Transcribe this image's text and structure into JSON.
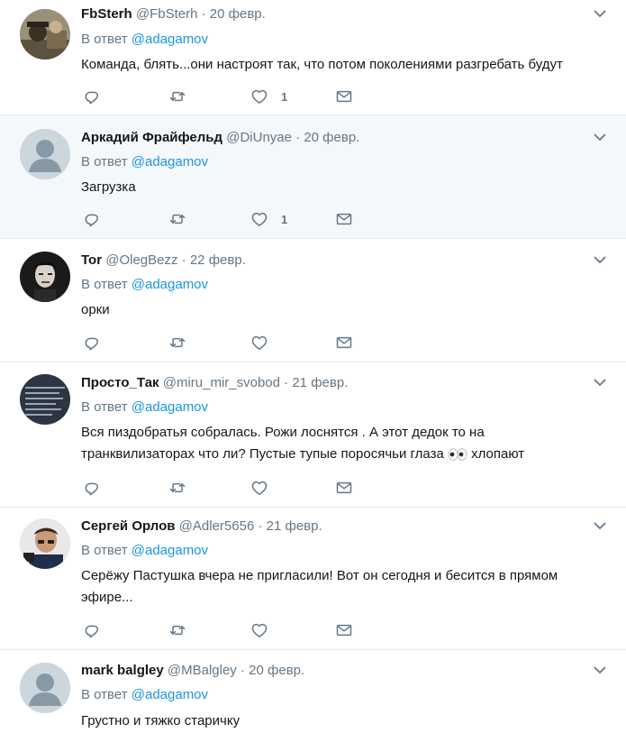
{
  "reply_prefix": "В ответ",
  "colors": {
    "link": "#1b95e0",
    "muted": "#657786",
    "highlight_bg": "#f5f8fa"
  },
  "tweets": [
    {
      "name": "FbSterh",
      "handle": "@FbSterh",
      "separator": "·",
      "date": "20 февр.",
      "reply_to": "@adagamov",
      "text": "Команда, блять...они настроят так, что потом поколениями разгребать будут",
      "like_count": "1",
      "avatar": "photo"
    },
    {
      "name": "Аркадий Фрайфельд",
      "handle": "@DiUnyae",
      "separator": "·",
      "date": "20 февр.",
      "reply_to": "@adagamov",
      "text": "Загрузка",
      "like_count": "1",
      "avatar": "default"
    },
    {
      "name": "Tor",
      "handle": "@OlegBezz",
      "separator": "·",
      "date": "22 февр.",
      "reply_to": "@adagamov",
      "text": "орки",
      "like_count": "",
      "avatar": "photo"
    },
    {
      "name": "Просто_Так",
      "handle": "@miru_mir_svobod",
      "separator": "·",
      "date": "21 февр.",
      "reply_to": "@adagamov",
      "text_line1": "Вся пиздобратья собралась. Рожи лоснятся . А этот дедок то на",
      "text_line2a": "транквилизаторах что ли? Пустые тупые поросячьи глаза",
      "text_line2b": "хлопают",
      "like_count": "",
      "avatar": "text-image"
    },
    {
      "name": "Сергей Орлов",
      "handle": "@Adler5656",
      "separator": "·",
      "date": "21 февр.",
      "reply_to": "@adagamov",
      "text_line1": "Серёжу Пастушка вчера не пригласили! Вот он сегодня и бесится в прямом",
      "text_line2": "эфире...",
      "like_count": "",
      "avatar": "photo"
    },
    {
      "name": "mark balgley",
      "handle": "@MBalgley",
      "separator": "·",
      "date": "20 февр.",
      "reply_to": "@adagamov",
      "text": "Грустно и тяжко старичку",
      "like_count": "",
      "avatar": "default"
    }
  ]
}
